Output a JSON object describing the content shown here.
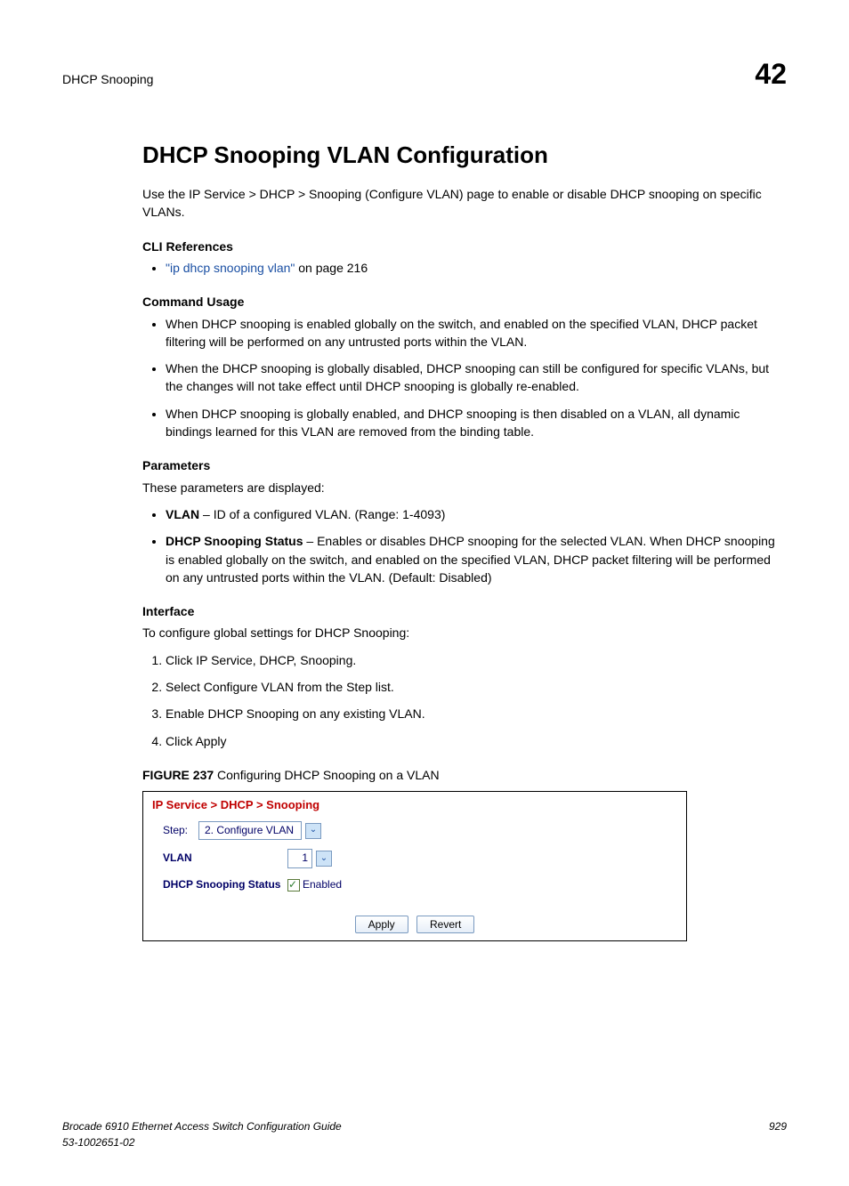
{
  "header": {
    "left": "DHCP Snooping",
    "right": "42"
  },
  "title": "DHCP Snooping VLAN Configuration",
  "intro": "Use the IP Service > DHCP > Snooping (Configure VLAN) page to enable or disable DHCP snooping on specific VLANs.",
  "cliRefsHead": "CLI References",
  "cliRef": {
    "link": "\"ip dhcp snooping vlan\"",
    "suffix": " on page 216"
  },
  "cmdUsageHead": "Command Usage",
  "cmdUsage": [
    "When DHCP snooping is enabled globally on the switch, and enabled on the specified VLAN, DHCP packet filtering will be performed on any untrusted ports within the VLAN.",
    "When the DHCP snooping is globally disabled, DHCP snooping can still be configured for specific VLANs, but the changes will not take effect until DHCP snooping is globally re-enabled.",
    "When DHCP snooping is globally enabled, and DHCP snooping is then disabled on a VLAN, all dynamic bindings learned for this VLAN are removed from the binding table."
  ],
  "paramsHead": "Parameters",
  "paramsIntro": "These parameters are displayed:",
  "params": [
    {
      "name": "VLAN",
      "desc": " – ID of a configured VLAN. (Range: 1-4093)"
    },
    {
      "name": "DHCP Snooping Status",
      "desc": " – Enables or disables DHCP snooping for the selected VLAN. When DHCP snooping is enabled globally on the switch, and enabled on the specified VLAN, DHCP packet filtering will be performed on any untrusted ports within the VLAN. (Default: Disabled)"
    }
  ],
  "ifaceHead": "Interface",
  "ifaceIntro": "To configure global settings for DHCP Snooping:",
  "steps": [
    "Click IP Service, DHCP, Snooping.",
    "Select Configure VLAN from the Step list.",
    "Enable DHCP Snooping on any existing VLAN.",
    "Click Apply"
  ],
  "figure": {
    "labelPrefix": "FIGURE 237",
    "labelText": "   Configuring DHCP Snooping on a VLAN",
    "breadcrumb": "IP Service > DHCP > Snooping",
    "stepLabel": "Step:",
    "stepValue": "2. Configure VLAN",
    "vlanLabel": "VLAN",
    "vlanValue": "1",
    "snoopLabel": "DHCP Snooping Status",
    "snoopValue": "Enabled",
    "applyBtn": "Apply",
    "revertBtn": "Revert"
  },
  "footer": {
    "line1": "Brocade 6910 Ethernet Access Switch Configuration Guide",
    "line2": "53-1002651-02",
    "page": "929"
  }
}
